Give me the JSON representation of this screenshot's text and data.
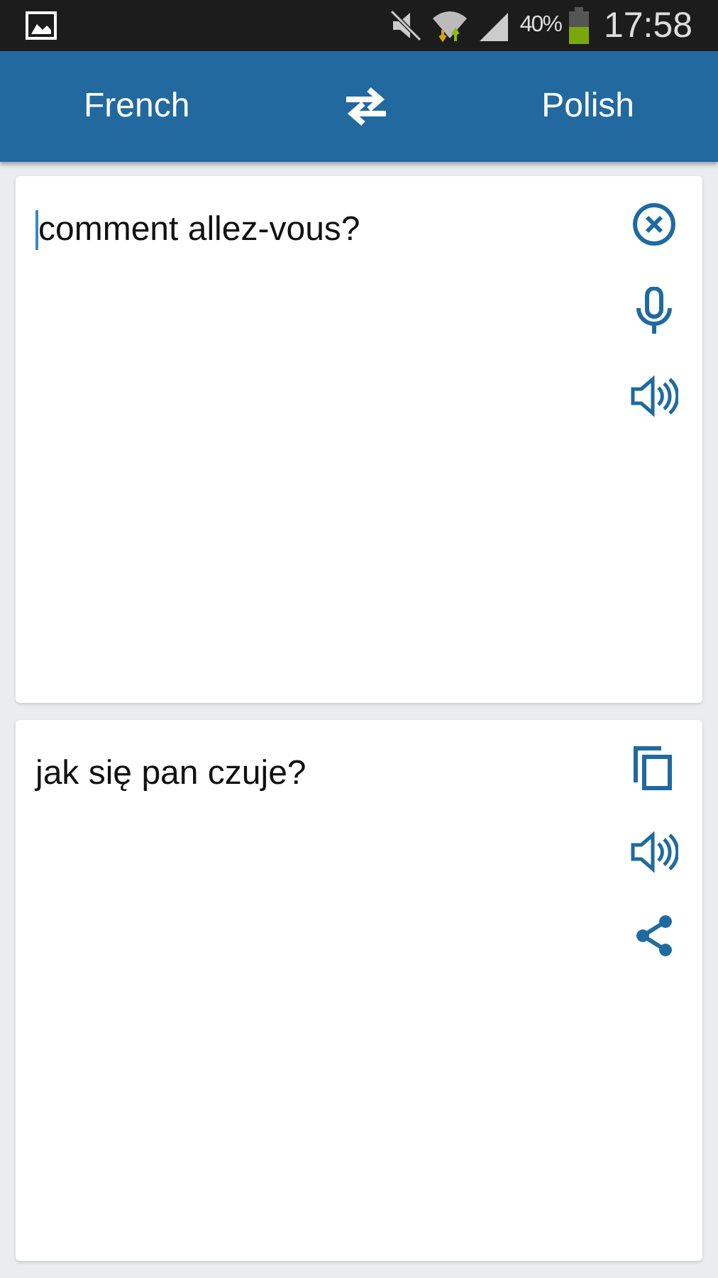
{
  "status_bar": {
    "battery_percent": "40%",
    "time": "17:58"
  },
  "header": {
    "source_language": "French",
    "target_language": "Polish"
  },
  "input_card": {
    "value": "comment allez-vous?"
  },
  "output_card": {
    "text": "jak się pan czuje?"
  }
}
